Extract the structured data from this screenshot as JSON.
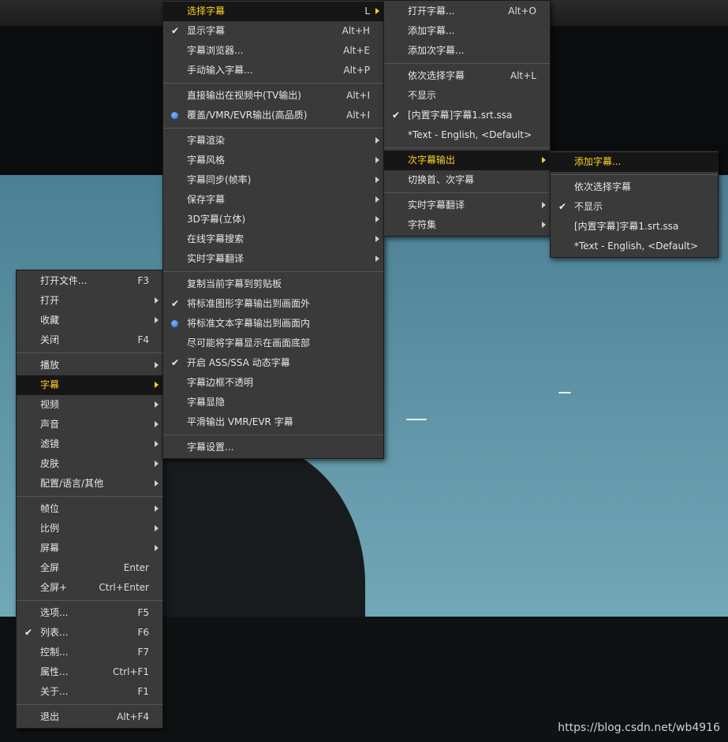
{
  "main_menu": [
    {
      "label": "打开文件...",
      "shortcut": "F3"
    },
    {
      "label": "打开",
      "submenu": true
    },
    {
      "label": "收藏",
      "submenu": true
    },
    {
      "label": "关闭",
      "shortcut": "F4"
    },
    {
      "sep": true
    },
    {
      "label": "播放",
      "submenu": true
    },
    {
      "label": "字幕",
      "submenu": true,
      "highlighted": true
    },
    {
      "label": "视频",
      "submenu": true
    },
    {
      "label": "声音",
      "submenu": true
    },
    {
      "label": "滤镜",
      "submenu": true
    },
    {
      "label": "皮肤",
      "submenu": true
    },
    {
      "label": "配置/语言/其他",
      "submenu": true
    },
    {
      "sep": true
    },
    {
      "label": "帧位",
      "submenu": true
    },
    {
      "label": "比例",
      "submenu": true
    },
    {
      "label": "屏幕",
      "submenu": true
    },
    {
      "label": "全屏",
      "shortcut": "Enter"
    },
    {
      "label": "全屏+",
      "shortcut": "Ctrl+Enter"
    },
    {
      "sep": true
    },
    {
      "label": "选项...",
      "shortcut": "F5"
    },
    {
      "label": "列表...",
      "shortcut": "F6",
      "check": true
    },
    {
      "label": "控制...",
      "shortcut": "F7"
    },
    {
      "label": "属性...",
      "shortcut": "Ctrl+F1"
    },
    {
      "label": "关于...",
      "shortcut": "F1"
    },
    {
      "sep": true
    },
    {
      "label": "退出",
      "shortcut": "Alt+F4"
    }
  ],
  "subtitle_menu": [
    {
      "label": "选择字幕",
      "shortcut": "L",
      "submenu": true,
      "highlighted": true
    },
    {
      "label": "显示字幕",
      "shortcut": "Alt+H",
      "check": true
    },
    {
      "label": "字幕浏览器...",
      "shortcut": "Alt+E"
    },
    {
      "label": "手动输入字幕...",
      "shortcut": "Alt+P"
    },
    {
      "sep": true
    },
    {
      "label": "直接输出在视频中(TV输出)",
      "shortcut": "Alt+I"
    },
    {
      "label": "覆盖/VMR/EVR输出(高品质)",
      "shortcut": "Alt+I",
      "radio": true
    },
    {
      "sep": true
    },
    {
      "label": "字幕渲染",
      "submenu": true
    },
    {
      "label": "字幕风格",
      "submenu": true
    },
    {
      "label": "字幕同步(帧率)",
      "submenu": true
    },
    {
      "label": "保存字幕",
      "submenu": true
    },
    {
      "label": "3D字幕(立体)",
      "submenu": true
    },
    {
      "label": "在线字幕搜索",
      "submenu": true
    },
    {
      "label": "实时字幕翻译",
      "submenu": true
    },
    {
      "sep": true
    },
    {
      "label": "复制当前字幕到剪贴板"
    },
    {
      "label": "将标准图形字幕输出到画面外",
      "check": true
    },
    {
      "label": "将标准文本字幕输出到画面内",
      "radio": true
    },
    {
      "label": "尽可能将字幕显示在画面底部"
    },
    {
      "label": "开启 ASS/SSA 动态字幕",
      "check": true
    },
    {
      "label": "字幕边框不透明"
    },
    {
      "label": "字幕显隐"
    },
    {
      "label": "平滑输出 VMR/EVR 字幕"
    },
    {
      "sep": true
    },
    {
      "label": "字幕设置..."
    }
  ],
  "select_subtitle_menu": [
    {
      "label": "打开字幕...",
      "shortcut": "Alt+O"
    },
    {
      "label": "添加字幕..."
    },
    {
      "label": "添加次字幕..."
    },
    {
      "sep": true
    },
    {
      "label": "依次选择字幕",
      "shortcut": "Alt+L"
    },
    {
      "label": "不显示"
    },
    {
      "label": "[内置字幕]字幕1.srt.ssa",
      "check": true
    },
    {
      "label": "*Text - English, <Default>"
    },
    {
      "sep": true
    },
    {
      "label": "次字幕输出",
      "submenu": true,
      "highlighted": true
    },
    {
      "label": "切换首、次字幕"
    },
    {
      "sep": true
    },
    {
      "label": "实时字幕翻译",
      "submenu": true
    },
    {
      "label": "字符集",
      "submenu": true
    }
  ],
  "secondary_output_menu": [
    {
      "label": "添加字幕...",
      "highlighted": true
    },
    {
      "sep": true
    },
    {
      "label": "依次选择字幕"
    },
    {
      "label": "不显示",
      "check": true
    },
    {
      "label": "[内置字幕]字幕1.srt.ssa"
    },
    {
      "label": "*Text - English, <Default>"
    }
  ],
  "watermark": "https://blog.csdn.net/wb4916"
}
